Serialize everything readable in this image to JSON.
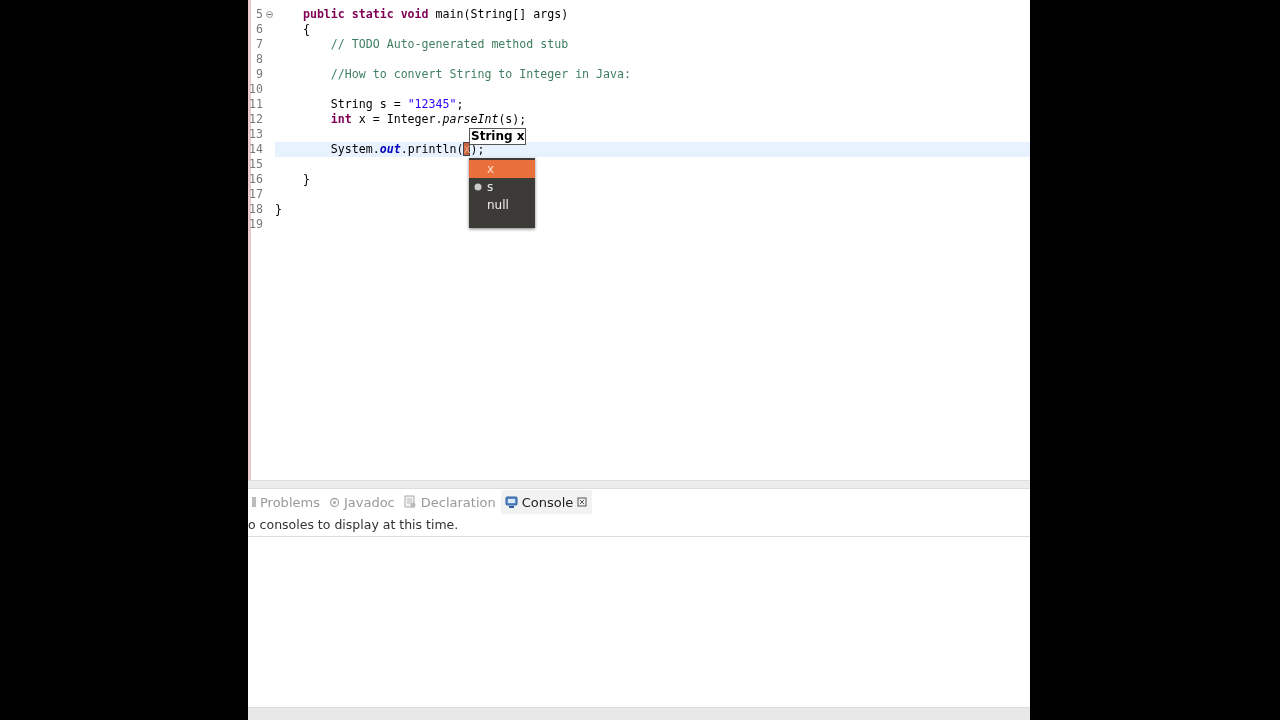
{
  "editor": {
    "lines": [
      {
        "number": "5",
        "foldable": true,
        "current": false,
        "tokens": [
          {
            "kind": "keyword",
            "text": "    public static void"
          },
          {
            "kind": "plain",
            "text": " main(String[] args)"
          }
        ]
      },
      {
        "number": "6",
        "foldable": false,
        "current": false,
        "tokens": [
          {
            "kind": "plain",
            "text": "    {"
          }
        ]
      },
      {
        "number": "7",
        "foldable": false,
        "current": false,
        "tokens": [
          {
            "kind": "comment",
            "text": "        // TODO Auto-generated method stub"
          }
        ]
      },
      {
        "number": "8",
        "foldable": false,
        "current": false
      },
      {
        "number": "9",
        "foldable": false,
        "current": false,
        "tokens": [
          {
            "kind": "comment",
            "text": "        //How to convert String to Integer in Java:"
          }
        ]
      },
      {
        "number": "10",
        "foldable": false,
        "current": false
      },
      {
        "number": "11",
        "foldable": false,
        "current": false,
        "tokens": [
          {
            "kind": "plain",
            "text": "        String s = "
          },
          {
            "kind": "string",
            "text": "\"12345\""
          },
          {
            "kind": "plain",
            "text": ";"
          }
        ]
      },
      {
        "number": "12",
        "foldable": false,
        "current": false,
        "tokens": [
          {
            "kind": "keyword",
            "text": "        int"
          },
          {
            "kind": "plain",
            "text": " x = Integer."
          },
          {
            "kind": "method",
            "text": "parseInt"
          },
          {
            "kind": "plain",
            "text": "(s);"
          }
        ]
      },
      {
        "number": "13",
        "foldable": false,
        "current": false
      },
      {
        "number": "14",
        "foldable": false,
        "current": true,
        "tokens": [
          {
            "kind": "plain",
            "text": "        System."
          },
          {
            "kind": "field",
            "text": "out"
          },
          {
            "kind": "plain",
            "text": ".println("
          },
          {
            "kind": "linked",
            "text": "x"
          },
          {
            "kind": "plain",
            "text": ");"
          }
        ]
      },
      {
        "number": "15",
        "foldable": false,
        "current": false
      },
      {
        "number": "16",
        "foldable": false,
        "current": false,
        "tokens": [
          {
            "kind": "plain",
            "text": "    }"
          }
        ]
      },
      {
        "number": "17",
        "foldable": false,
        "current": false
      },
      {
        "number": "18",
        "foldable": false,
        "current": false,
        "tokens": [
          {
            "kind": "plain",
            "text": "}"
          }
        ]
      },
      {
        "number": "19",
        "foldable": false,
        "current": false
      }
    ],
    "tooltip": "String x",
    "proposals": [
      {
        "label": "x",
        "selected": true,
        "kind": "plain"
      },
      {
        "label": "s",
        "selected": false,
        "kind": "variable"
      },
      {
        "label": "null",
        "selected": false,
        "kind": "plain"
      }
    ]
  },
  "panel": {
    "tabs": [
      {
        "label": "Problems",
        "selected": false,
        "kind": "problems"
      },
      {
        "label": "Javadoc",
        "selected": false,
        "kind": "javadoc"
      },
      {
        "label": "Declaration",
        "selected": false,
        "kind": "declaration"
      },
      {
        "label": "Console",
        "selected": true,
        "kind": "console"
      }
    ],
    "message": "o consoles to display at this time."
  }
}
